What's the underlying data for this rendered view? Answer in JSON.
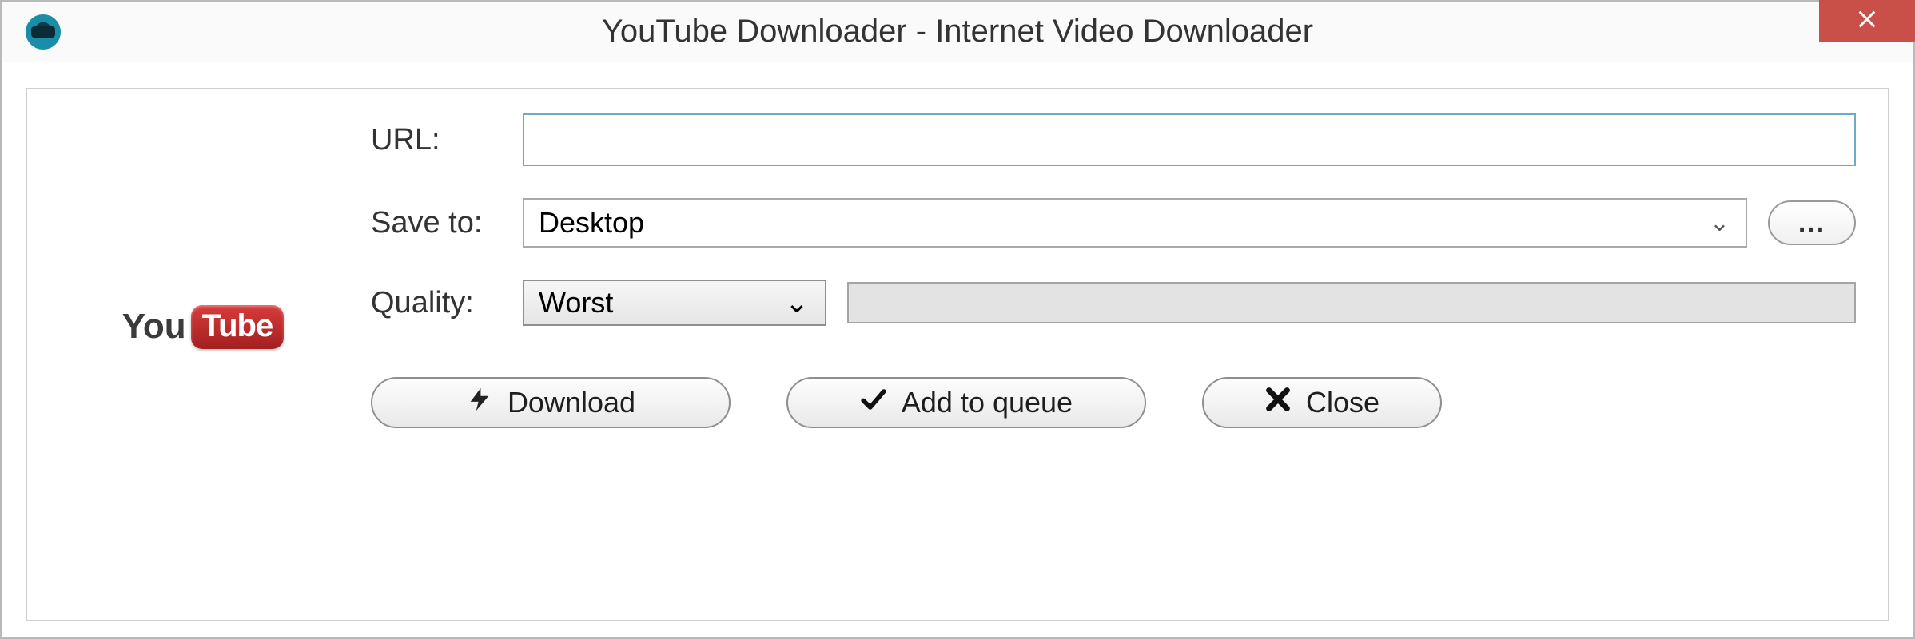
{
  "window": {
    "title": "YouTube Downloader - Internet Video Downloader"
  },
  "form": {
    "url": {
      "label": "URL:",
      "value": ""
    },
    "save_to": {
      "label": "Save to:",
      "selected": "Desktop",
      "browse_label": "..."
    },
    "quality": {
      "label": "Quality:",
      "selected": "Worst"
    }
  },
  "buttons": {
    "download": "Download",
    "add_queue": "Add to queue",
    "close": "Close"
  },
  "logo": {
    "part1": "You",
    "part2": "Tube"
  }
}
